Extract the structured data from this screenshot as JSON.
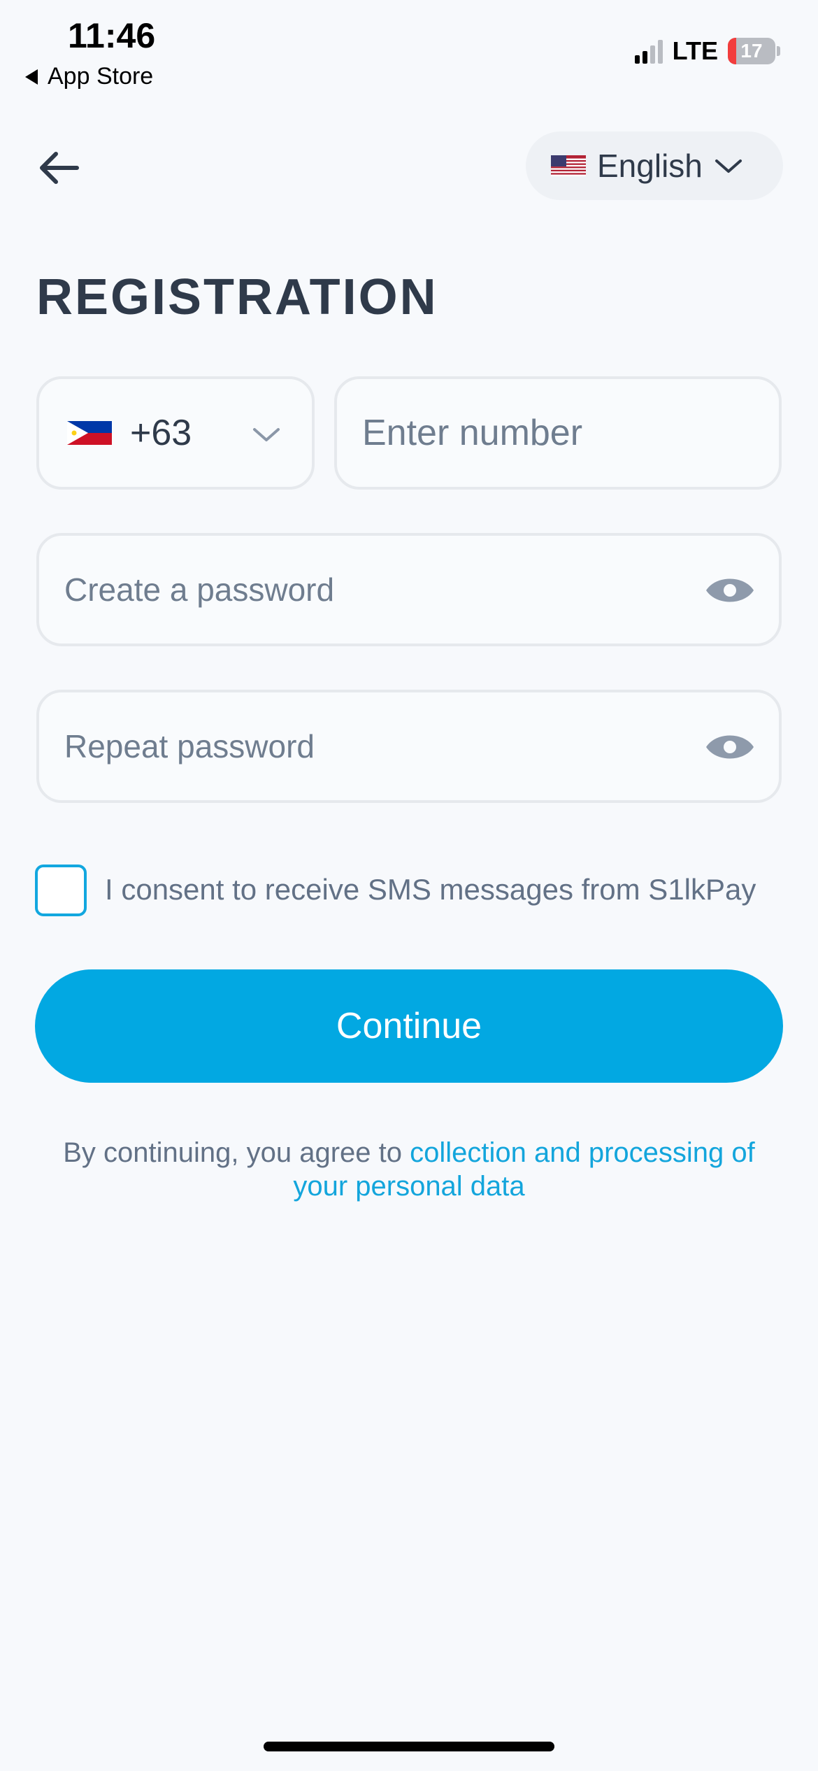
{
  "status_bar": {
    "time": "11:46",
    "back_app": "App Store",
    "network": "LTE",
    "battery_level": "17",
    "battery_color": "#f23d3d"
  },
  "nav": {
    "back_icon": "arrow-left-icon",
    "language": {
      "flag": "us-flag-icon",
      "label": "English"
    }
  },
  "form": {
    "title": "REGISTRATION",
    "country": {
      "flag": "ph-flag-icon",
      "code": "+63"
    },
    "phone_placeholder": "Enter number",
    "password_placeholder": "Create a password",
    "repeat_password_placeholder": "Repeat password",
    "consent_label": "I consent to receive SMS messages from S1lkPay",
    "continue_label": "Continue",
    "terms_prefix": "By continuing, you agree to ",
    "terms_link": "collection and processing of your personal data"
  },
  "colors": {
    "accent": "#02a8e2",
    "link": "#13a5dc",
    "title": "#2f3a4a",
    "background": "#f7f9fc"
  }
}
